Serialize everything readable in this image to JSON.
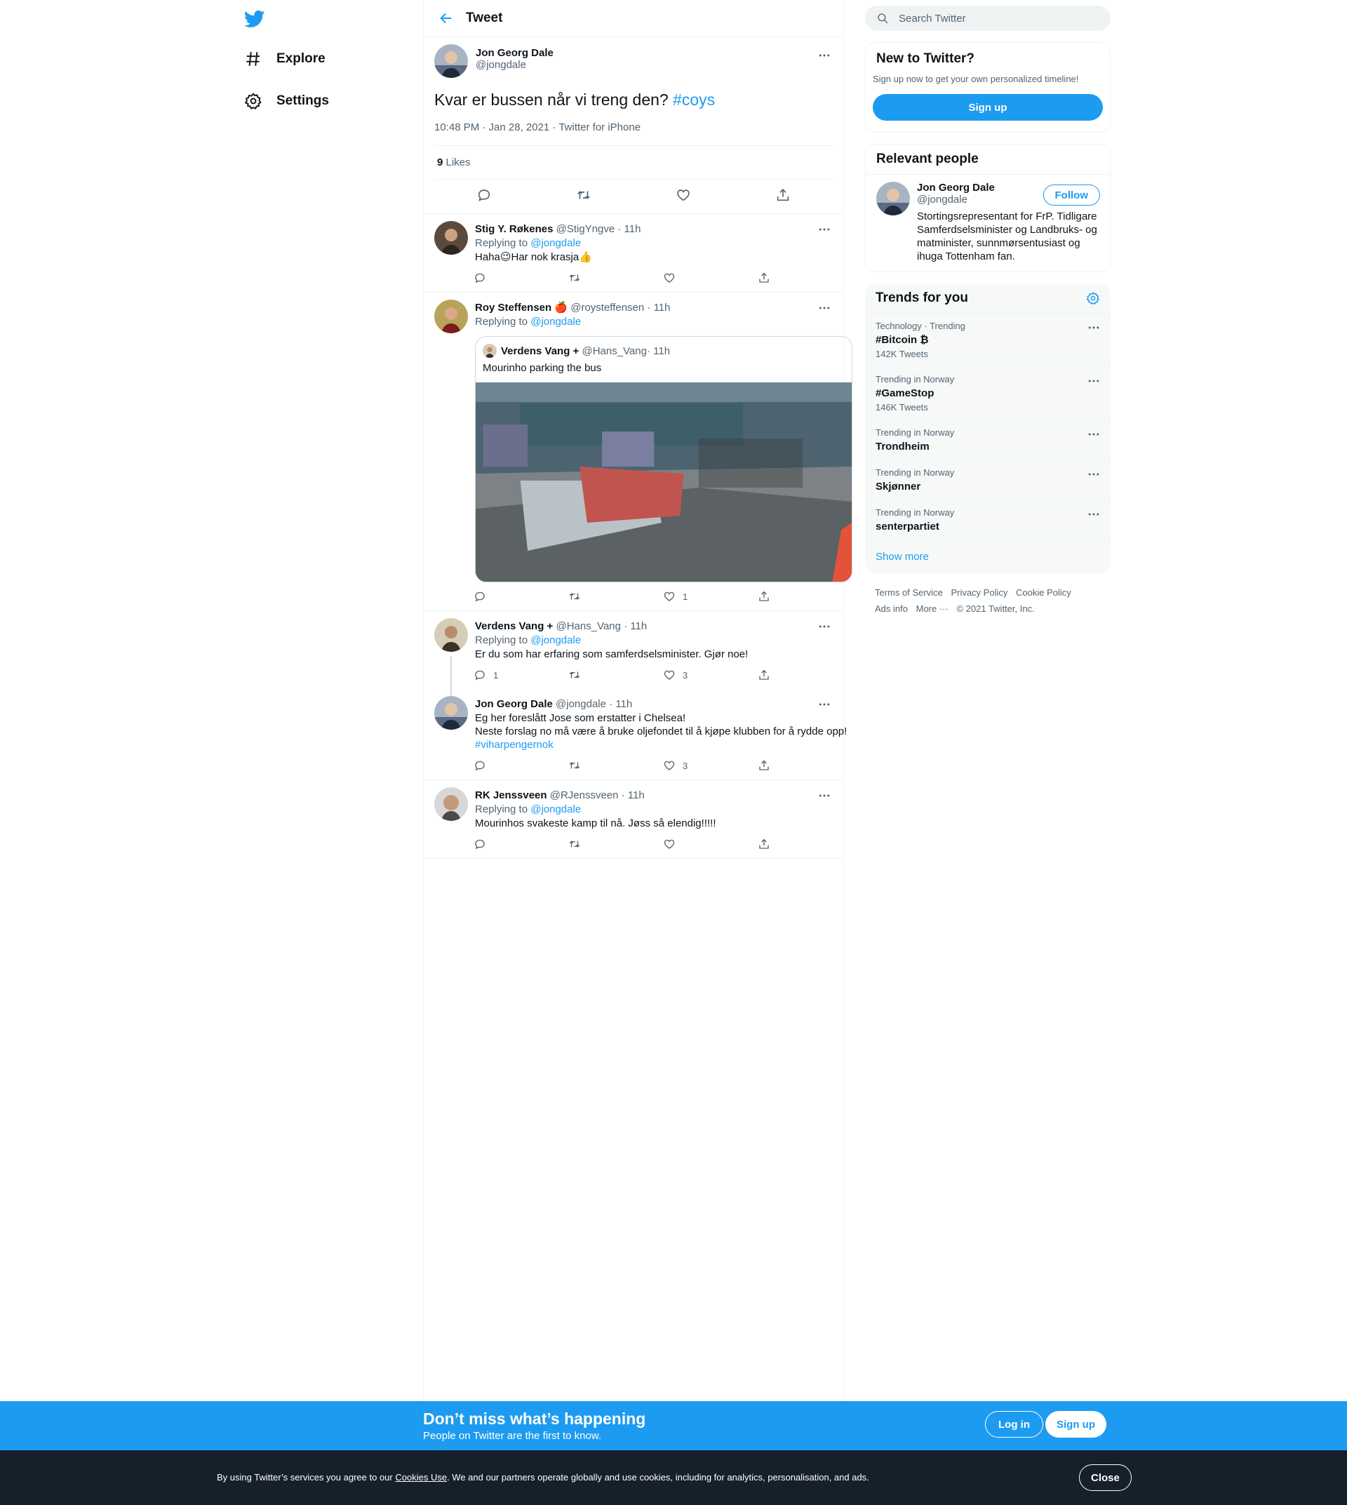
{
  "nav": {
    "items": [
      {
        "label": "Explore",
        "icon": "hashtag-icon"
      },
      {
        "label": "Settings",
        "icon": "gear-icon"
      }
    ]
  },
  "header": {
    "title": "Tweet"
  },
  "main_tweet": {
    "name": "Jon Georg Dale",
    "handle": "@jongdale",
    "text": "Kvar er bussen når vi treng den? ",
    "hashtag": "#coys",
    "meta": "10:48 PM · Jan 28, 2021 · Twitter for iPhone",
    "likes_count": "9",
    "likes_label": " Likes"
  },
  "replies": [
    {
      "name": "Stig Y. Røkenes",
      "handle": "@StigYngve",
      "time": " · 11h",
      "replying_prefix": "Replying to ",
      "replying_to": "@jongdale",
      "text": "Haha😉Har nok krasja👍",
      "reply_count": "",
      "retweet_count": "",
      "like_count": ""
    },
    {
      "name": "Roy Steffensen 🍎",
      "handle": "@roysteffensen",
      "time": " · 11h",
      "replying_prefix": "Replying to ",
      "replying_to": "@jongdale",
      "quote": {
        "name": "Verdens Vang +",
        "handle": "@Hans_Vang",
        "time": " · 11h",
        "text": "Mourinho parking the bus"
      },
      "reply_count": "",
      "retweet_count": "",
      "like_count": "1"
    },
    {
      "name": "Verdens Vang +",
      "handle": "@Hans_Vang",
      "time": " · 11h",
      "replying_prefix": "Replying to ",
      "replying_to": "@jongdale",
      "text": "Er du som har erfaring som samferdselsminister. Gjør noe!",
      "reply_count": "1",
      "retweet_count": "",
      "like_count": "3"
    },
    {
      "name": "Jon Georg Dale",
      "handle": "@jongdale",
      "time": " · 11h",
      "text_lines": [
        "Eg her foreslått Jose som erstatter i Chelsea!",
        "Neste forslag no må være å bruke oljefondet til å kjøpe klubben for å rydde opp! "
      ],
      "hashtag": "#viharpengernok",
      "reply_count": "",
      "retweet_count": "",
      "like_count": "3"
    },
    {
      "name": "RK Jenssveen",
      "handle": "@RJenssveen",
      "time": " · 11h",
      "replying_prefix": "Replying to ",
      "replying_to": "@jongdale",
      "text": "Mourinhos svakeste kamp til nå. Jøss så elendig!!!!!",
      "reply_count": "",
      "retweet_count": "",
      "like_count": ""
    }
  ],
  "search": {
    "placeholder": "Search Twitter"
  },
  "new_to_twitter": {
    "title": "New to Twitter?",
    "subtitle": "Sign up now to get your own personalized timeline!",
    "button": "Sign up"
  },
  "relevant_people": {
    "title": "Relevant people",
    "name": "Jon Georg Dale",
    "handle": "@jongdale",
    "follow": "Follow",
    "bio": "Stortingsrepresentant for FrP. Tidligare Samferdselsminister og Landbruks- og matminister, sunnmørsentusiast og ihuga Tottenham fan."
  },
  "trends": {
    "title": "Trends for you",
    "items": [
      {
        "context": "Technology · Trending",
        "name": "#Bitcoin ₿",
        "count": "142K Tweets"
      },
      {
        "context": "Trending in Norway",
        "name": "#GameStop",
        "count": "146K Tweets"
      },
      {
        "context": "Trending in Norway",
        "name": "Trondheim",
        "count": ""
      },
      {
        "context": "Trending in Norway",
        "name": "Skjønner",
        "count": ""
      },
      {
        "context": "Trending in Norway",
        "name": "senterpartiet",
        "count": ""
      }
    ],
    "show_more": "Show more"
  },
  "footer": {
    "links": [
      "Terms of Service",
      "Privacy Policy",
      "Cookie Policy",
      "Ads info",
      "More ···",
      "© 2021 Twitter, Inc."
    ]
  },
  "signup_bar": {
    "title": "Don’t miss what’s happening",
    "subtitle": "People on Twitter are the first to know.",
    "login": "Log in",
    "signup": "Sign up"
  },
  "cookie_bar": {
    "prefix": "By using Twitter’s services you agree to our ",
    "link": "Cookies Use",
    "suffix": ". We and our partners operate globally and use cookies, including for analytics, personalisation, and ads.",
    "close": "Close"
  },
  "colors": {
    "accent": "#1d9bf0",
    "text": "#0f1419",
    "muted": "#536471",
    "border": "#eff3f4",
    "cookie_bg": "#15202b"
  }
}
